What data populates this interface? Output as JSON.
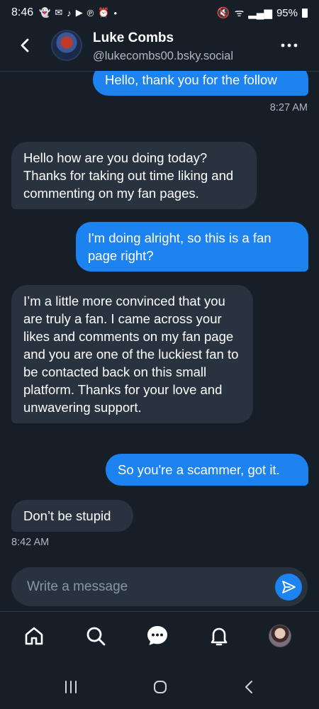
{
  "status_bar": {
    "time": "8:46",
    "battery": "95%"
  },
  "header": {
    "name": "Luke Combs",
    "handle": "@lukecombs00.bsky.social"
  },
  "messages": [
    {
      "direction": "out",
      "text": "Hello, thank you for the follow"
    },
    {
      "direction": "in",
      "text": "Hello how are you doing today? Thanks for taking out time liking and commenting on my fan pages."
    },
    {
      "direction": "out",
      "text": "I'm doing alright, so this is a fan page right?"
    },
    {
      "direction": "in",
      "text": "I’m a little more convinced that you are truly a fan. I came across your likes and comments on my fan page and you are one of the luckiest fan to be contacted back on this small platform. Thanks for your love and unwavering support."
    },
    {
      "direction": "out",
      "text": "So you're a scammer, got it."
    },
    {
      "direction": "in",
      "text": "Don’t be stupid"
    }
  ],
  "timestamps": {
    "first": "8:27 AM",
    "last": "8:42 AM"
  },
  "composer": {
    "placeholder": "Write a message",
    "value": ""
  },
  "tabs": [
    "home",
    "search",
    "messages",
    "notifications",
    "profile"
  ],
  "icons": {
    "back": "chevron-left-icon",
    "more": "ellipsis-icon",
    "send": "send-icon",
    "home": "home-icon",
    "search": "search-icon",
    "chat": "chat-bubble-icon",
    "bell": "bell-icon"
  },
  "colors": {
    "background": "#161e27",
    "outgoing_bubble": "#1d83f1",
    "incoming_bubble": "#28333f",
    "accent": "#1d83f1"
  }
}
